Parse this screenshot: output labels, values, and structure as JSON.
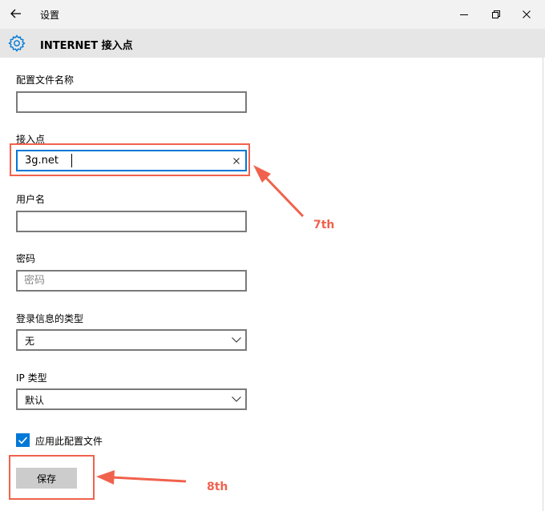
{
  "window": {
    "title": "设置"
  },
  "page": {
    "title": "INTERNET 接入点"
  },
  "form": {
    "profile_name": {
      "label": "配置文件名称",
      "value": ""
    },
    "apn": {
      "label": "接入点",
      "value": "3g.net"
    },
    "username": {
      "label": "用户名",
      "value": ""
    },
    "password": {
      "label": "密码",
      "placeholder": "密码"
    },
    "login_type": {
      "label": "登录信息的类型",
      "selected": "无"
    },
    "ip_type": {
      "label": "IP 类型",
      "selected": "默认"
    },
    "apply_profile": {
      "label": "应用此配置文件",
      "checked": true
    },
    "save_label": "保存"
  },
  "annotations": {
    "step7": "7th",
    "step8": "8th",
    "color": "#f0624d"
  },
  "colors": {
    "accent": "#0078d7",
    "titlebar": "#f2f2f2",
    "header": "#e6e6e6"
  }
}
